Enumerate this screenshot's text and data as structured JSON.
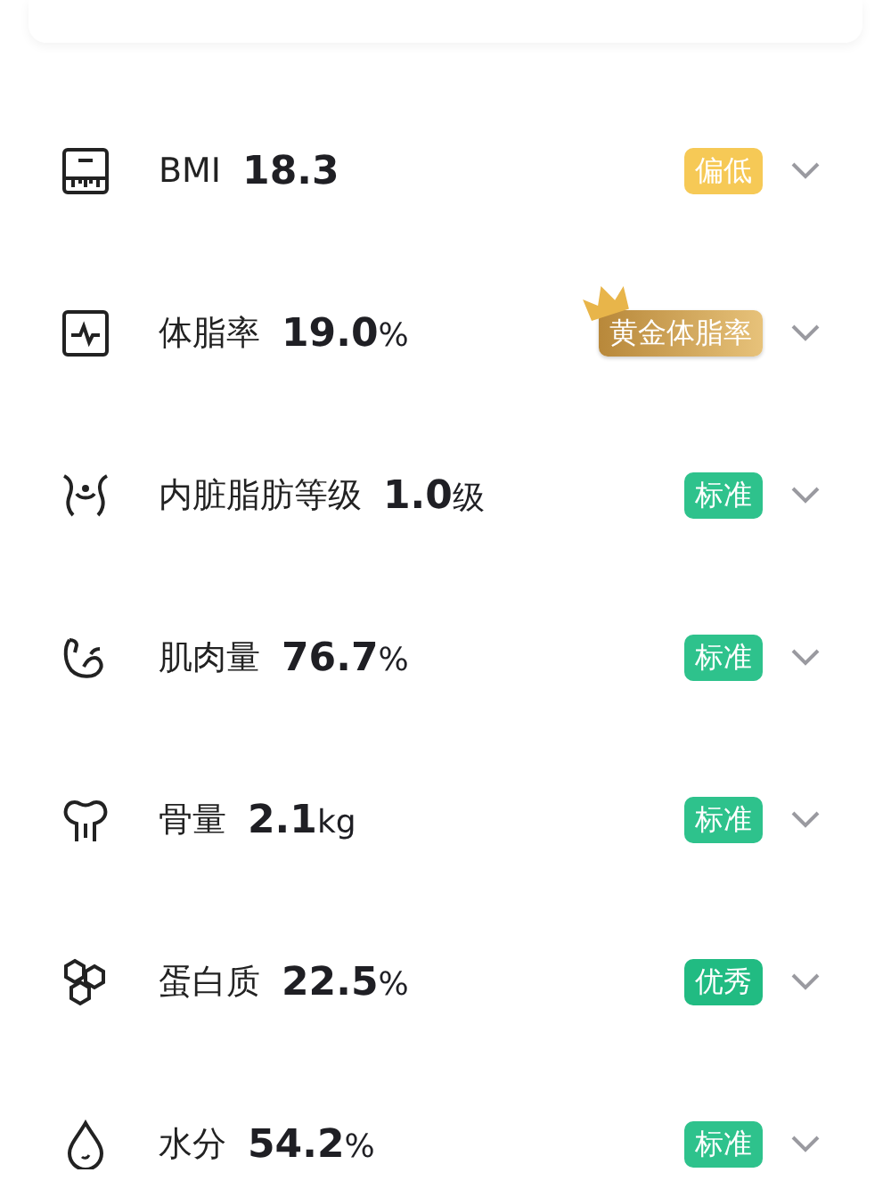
{
  "metrics": [
    {
      "name": "BMI",
      "value": "18.3",
      "badge": {
        "label": "偏低",
        "kind": "low"
      }
    },
    {
      "name": "体脂率",
      "value": "19.0",
      "unit": "%",
      "badge": {
        "label": "黄金体脂率",
        "kind": "gold"
      }
    },
    {
      "name": "内脏脂肪等级",
      "value": "1.0",
      "unit": "级",
      "badge": {
        "label": "标准",
        "kind": "standard"
      }
    },
    {
      "name": "肌肉量",
      "value": "76.7",
      "unit": "%",
      "badge": {
        "label": "标准",
        "kind": "standard"
      }
    },
    {
      "name": "骨量",
      "value": "2.1",
      "unit": "kg",
      "badge": {
        "label": "标准",
        "kind": "standard"
      }
    },
    {
      "name": "蛋白质",
      "value": "22.5",
      "unit": "%",
      "badge": {
        "label": "优秀",
        "kind": "excellent"
      }
    },
    {
      "name": "水分",
      "value": "54.2",
      "unit": "%",
      "badge": {
        "label": "标准",
        "kind": "standard"
      }
    }
  ]
}
